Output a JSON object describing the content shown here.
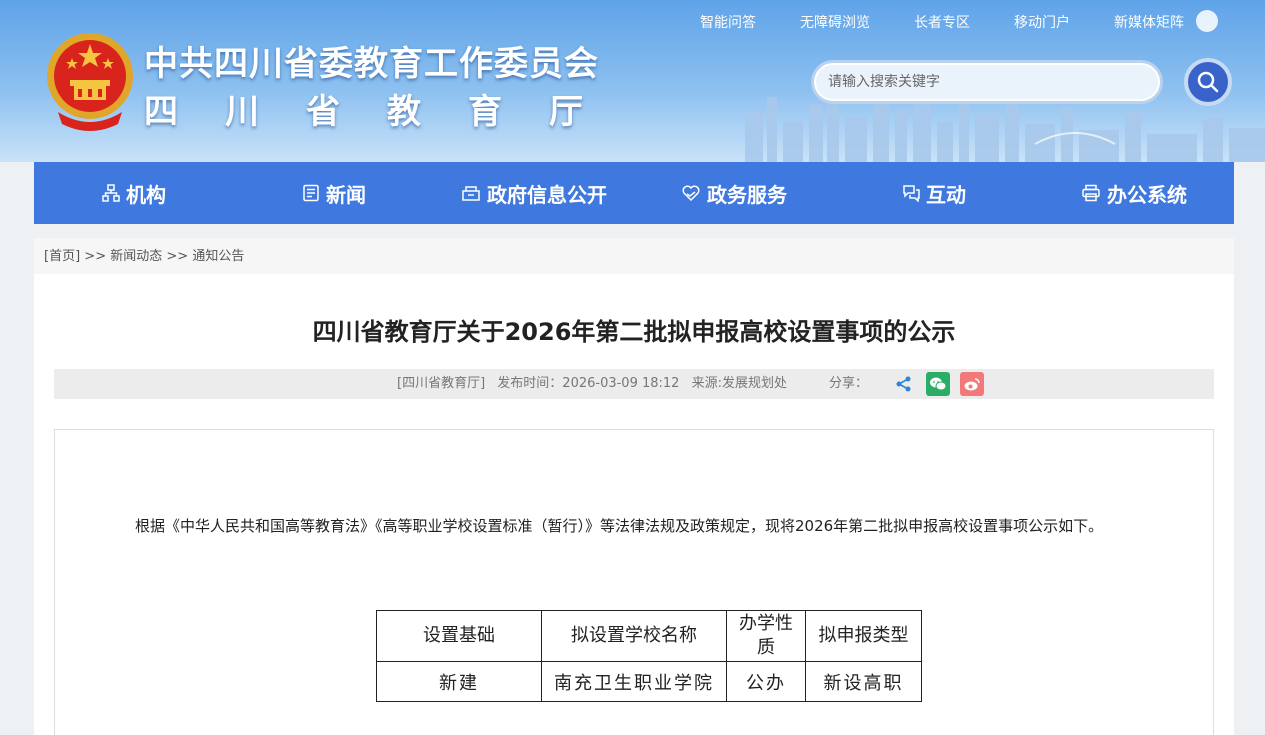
{
  "header": {
    "org_title": "中共四川省委教育工作委员会",
    "dept_title": "四川省教育厅",
    "top_links": [
      "智能问答",
      "无障碍浏览",
      "长者专区",
      "移动门户",
      "新媒体矩阵"
    ],
    "search": {
      "placeholder": "请输入搜索关键字"
    }
  },
  "nav": {
    "items": [
      {
        "label": "机构",
        "icon": "org-chart-icon"
      },
      {
        "label": "新闻",
        "icon": "news-icon"
      },
      {
        "label": "政府信息公开",
        "icon": "gov-info-icon"
      },
      {
        "label": "政务服务",
        "icon": "heart-hand-icon"
      },
      {
        "label": "互动",
        "icon": "chat-icon"
      },
      {
        "label": "办公系统",
        "icon": "printer-icon"
      }
    ]
  },
  "breadcrumb": {
    "home": "[首页]",
    "sep": ">>",
    "level1": "新闻动态",
    "level2": "通知公告"
  },
  "article": {
    "title": "四川省教育厅关于2026年第二批拟申报高校设置事项的公示",
    "meta": {
      "source": "[四川省教育厅]",
      "publish_time": "发布时间：2026-03-09 18:12",
      "origin": "来源:发展规划处",
      "share_label": "分享："
    },
    "paragraph": "根据《中华人民共和国高等教育法》《高等职业学校设置标准（暂行）》等法律法规及政策规定，现将2026年第二批拟申报高校设置事项公示如下。",
    "table": {
      "headers": [
        "设置基础",
        "拟设置学校名称",
        "办学性质",
        "拟申报类型"
      ],
      "rows": [
        [
          "新建",
          "南充卫生职业学院",
          "公办",
          "新设高职"
        ]
      ]
    }
  },
  "colors": {
    "nav_bg": "#3f79e0",
    "search_btn": "#3a63c9",
    "wechat": "#2aae67",
    "weibo": "#f2787a",
    "share": "#2a86d9"
  }
}
